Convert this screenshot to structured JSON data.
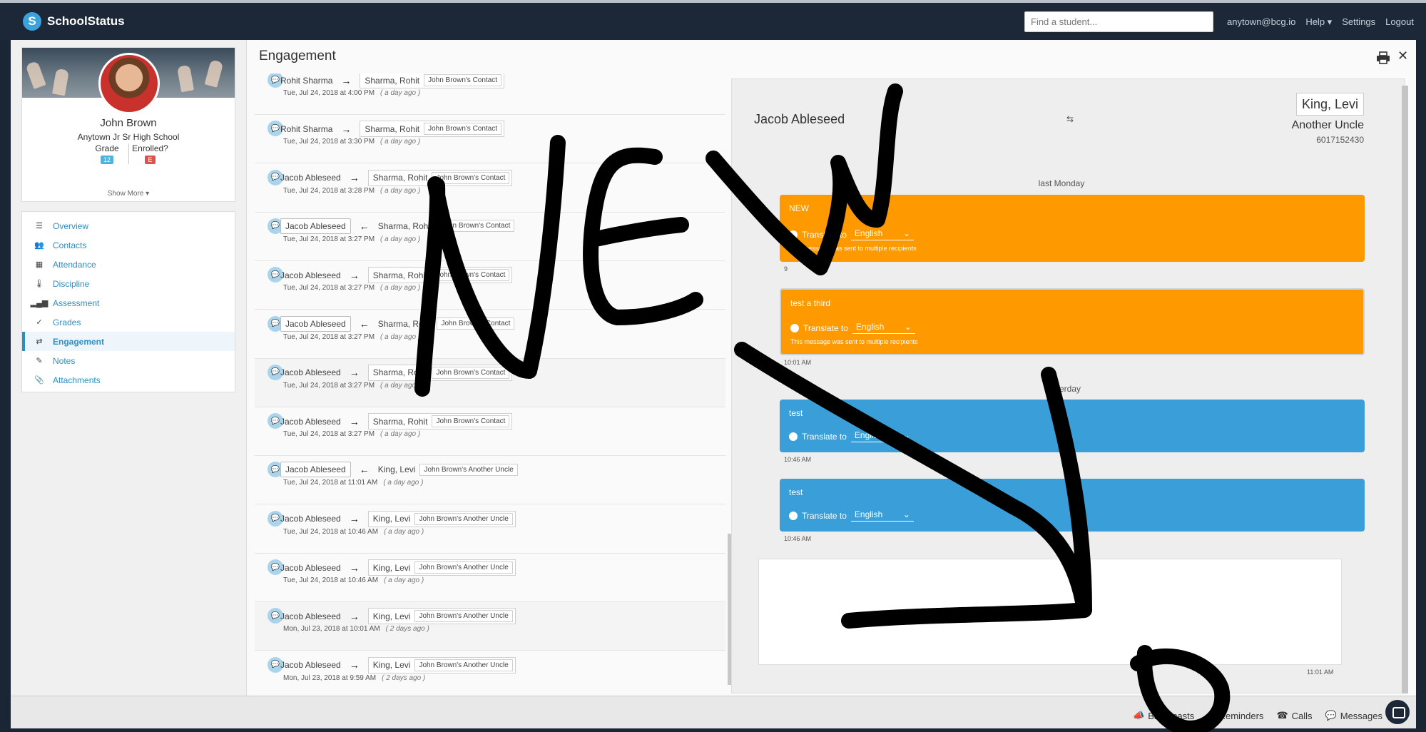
{
  "topbar": {
    "brand": "SchoolStatus",
    "brand_logo_letter": "S",
    "search_placeholder": "Find a student...",
    "user_email": "anytown@bcg.io",
    "help": "Help ▾",
    "settings": "Settings",
    "logout": "Logout"
  },
  "profile": {
    "name": "John Brown",
    "school": "Anytown Jr Sr High School",
    "grade_label": "Grade",
    "grade_value": "12",
    "enrolled_label": "Enrolled?",
    "enrolled_value": "E",
    "show_more": "Show More ▾"
  },
  "sidebar": {
    "items": [
      {
        "label": "Overview",
        "icon": "list-icon"
      },
      {
        "label": "Contacts",
        "icon": "users-icon"
      },
      {
        "label": "Attendance",
        "icon": "calendar-icon"
      },
      {
        "label": "Discipline",
        "icon": "thermometer-icon"
      },
      {
        "label": "Assessment",
        "icon": "bar-chart-icon"
      },
      {
        "label": "Grades",
        "icon": "check-icon"
      },
      {
        "label": "Engagement",
        "icon": "swap-icon"
      },
      {
        "label": "Notes",
        "icon": "pencil-icon"
      },
      {
        "label": "Attachments",
        "icon": "paperclip-icon"
      }
    ]
  },
  "main": {
    "title": "Engagement"
  },
  "messages": [
    {
      "from": "Rohit Sharma",
      "dir": "→",
      "to": "Sharma, Rohit",
      "tag": "John Brown's Contact",
      "time": "Tue, Jul 24, 2018 at 4:00 PM",
      "ago": "( a day ago )"
    },
    {
      "from": "Rohit Sharma",
      "dir": "→",
      "to": "Sharma, Rohit",
      "tag": "John Brown's Contact",
      "time": "Tue, Jul 24, 2018 at 3:30 PM",
      "ago": "( a day ago )"
    },
    {
      "from": "Jacob Ableseed",
      "dir": "→",
      "to": "Sharma, Rohit",
      "tag": "John Brown's Contact",
      "time": "Tue, Jul 24, 2018 at 3:28 PM",
      "ago": "( a day ago )"
    },
    {
      "from": "Jacob Ableseed",
      "dir": "←",
      "to": "Sharma, Rohit",
      "tag": "John Brown's Contact",
      "time": "Tue, Jul 24, 2018 at 3:27 PM",
      "ago": "( a day ago )"
    },
    {
      "from": "Jacob Ableseed",
      "dir": "→",
      "to": "Sharma, Rohit",
      "tag": "John Brown's Contact",
      "time": "Tue, Jul 24, 2018 at 3:27 PM",
      "ago": "( a day ago )"
    },
    {
      "from": "Jacob Ableseed",
      "dir": "←",
      "to": "Sharma, Rohit",
      "tag": "John Brown's Contact",
      "time": "Tue, Jul 24, 2018 at 3:27 PM",
      "ago": "( a day ago )"
    },
    {
      "from": "Jacob Ableseed",
      "dir": "→",
      "to": "Sharma, Rohit",
      "tag": "John Brown's Contact",
      "time": "Tue, Jul 24, 2018 at 3:27 PM",
      "ago": "( a day ago )"
    },
    {
      "from": "Jacob Ableseed",
      "dir": "→",
      "to": "Sharma, Rohit",
      "tag": "John Brown's Contact",
      "time": "Tue, Jul 24, 2018 at 3:27 PM",
      "ago": "( a day ago )"
    },
    {
      "from": "Jacob Ableseed",
      "dir": "←",
      "to": "King, Levi",
      "tag": "John Brown's Another Uncle",
      "time": "Tue, Jul 24, 2018 at 11:01 AM",
      "ago": "( a day ago )"
    },
    {
      "from": "Jacob Ableseed",
      "dir": "→",
      "to": "King, Levi",
      "tag": "John Brown's Another Uncle",
      "time": "Tue, Jul 24, 2018 at 10:46 AM",
      "ago": "( a day ago )"
    },
    {
      "from": "Jacob Ableseed",
      "dir": "→",
      "to": "King, Levi",
      "tag": "John Brown's Another Uncle",
      "time": "Tue, Jul 24, 2018 at 10:46 AM",
      "ago": "( a day ago )"
    },
    {
      "from": "Jacob Ableseed",
      "dir": "→",
      "to": "King, Levi",
      "tag": "John Brown's Another Uncle",
      "time": "Mon, Jul 23, 2018 at 10:01 AM",
      "ago": "( 2 days ago )"
    },
    {
      "from": "Jacob Ableseed",
      "dir": "→",
      "to": "King, Levi",
      "tag": "John Brown's Another Uncle",
      "time": "Mon, Jul 23, 2018 at 9:59 AM",
      "ago": "( 2 days ago )"
    }
  ],
  "conversation": {
    "left_name": "Jacob Ableseed",
    "right_name": "King, Levi",
    "right_role": "Another Uncle",
    "right_phone": "6017152430",
    "date_1": "last Monday",
    "date_2": "erday",
    "translate_label": "Translate to",
    "language": "English",
    "multi_note": "This message was sent to multiple recipients",
    "bubbles": [
      {
        "text": "NEW",
        "time": "9"
      },
      {
        "text": "test a third",
        "time": "10:01 AM"
      },
      {
        "text": "test",
        "time": "10:46 AM"
      },
      {
        "text": "test",
        "time": "10:46 AM"
      }
    ],
    "compose_time": "11:01 AM"
  },
  "footer": {
    "broadcasts": "Broadcasts",
    "reminders": "Reminders",
    "calls": "Calls",
    "messages": "Messages"
  },
  "annotation": {
    "text": "NEW",
    "color": "#000000"
  },
  "colors": {
    "nav_bg": "#1c2838",
    "accent": "#2a8fc7",
    "outgoing_bubble": "#ff9900",
    "incoming_bubble": "#3a9fd8"
  }
}
